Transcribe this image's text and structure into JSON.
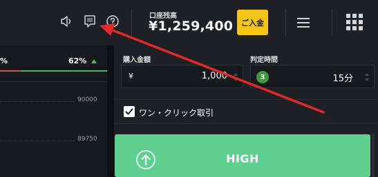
{
  "header": {
    "icons": [
      "speaker-icon",
      "message-icon",
      "help-icon",
      "menu-icon",
      "grid-icon"
    ],
    "balance_label": "口座残高",
    "balance_value": "¥1,259,400",
    "deposit_label": "ご入金"
  },
  "chart": {
    "left_percent": "%",
    "right_percent": "62%",
    "price_ticks": [
      "90000",
      "89750"
    ]
  },
  "trade": {
    "amount_label": "購入金額",
    "currency_symbol": "¥",
    "amount_value": "1,000",
    "time_label": "判定時間",
    "time_badge": "3",
    "time_value": "15分",
    "one_click_label": "ワン・クリック取引",
    "one_click_checked": true,
    "high_label": "HIGH"
  },
  "colors": {
    "deposit_button": "#f5c518",
    "high_button": "#5ecf8e",
    "time_badge": "#3f9a3f",
    "annotation_arrow": "#e0292b"
  }
}
